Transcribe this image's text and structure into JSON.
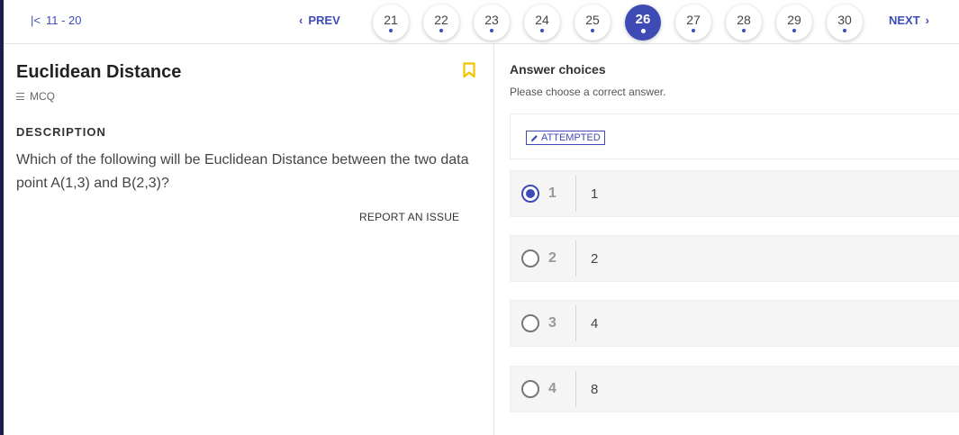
{
  "nav": {
    "range_label": "11 - 20",
    "prev_label": "PREV",
    "next_label": "NEXT",
    "pages": [
      "21",
      "22",
      "23",
      "24",
      "25",
      "26",
      "27",
      "28",
      "29",
      "30"
    ],
    "active_page": "26"
  },
  "question": {
    "title": "Euclidean Distance",
    "type": "MCQ",
    "description_heading": "DESCRIPTION",
    "description": "Which of the following will be Euclidean Distance between the two data point A(1,3) and B(2,3)?",
    "report_label": "REPORT AN ISSUE"
  },
  "answers": {
    "heading": "Answer choices",
    "subheading": "Please choose a correct answer.",
    "status": "ATTEMPTED",
    "choices": [
      {
        "num": "1",
        "text": "1",
        "selected": true
      },
      {
        "num": "2",
        "text": "2",
        "selected": false
      },
      {
        "num": "3",
        "text": "4",
        "selected": false
      },
      {
        "num": "4",
        "text": "8",
        "selected": false
      }
    ]
  },
  "colors": {
    "accent": "#3f4bb5",
    "bookmark": "#f2c500",
    "sidebar": "#1c1f4a"
  }
}
